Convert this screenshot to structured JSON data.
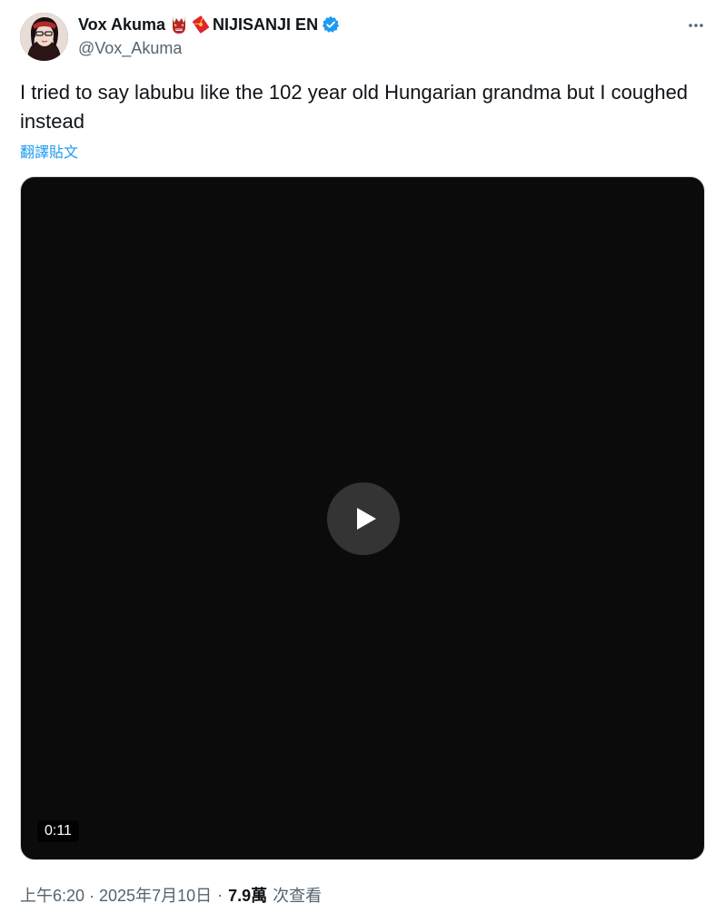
{
  "author": {
    "display_name": "Vox Akuma",
    "affiliation": "NIJISANJI EN",
    "handle": "@Vox_Akuma",
    "emojis": [
      "demon-mask-icon",
      "red-envelope-icon"
    ],
    "verified_icon": "verified-badge-icon",
    "avatar": "avatar"
  },
  "header": {
    "more_icon": "more-options-icon"
  },
  "tweet": {
    "text": "I tried to say labubu like the 102 year old Hungarian grandma but I coughed instead",
    "translate_label": "翻譯貼文"
  },
  "media": {
    "type": "video",
    "duration": "0:11",
    "play_icon": "play-icon"
  },
  "meta": {
    "timestamp": "上午6:20 · 2025年7月10日",
    "separator": "·",
    "views_count": "7.9萬",
    "views_label": "次查看"
  },
  "colors": {
    "accent": "#1d9bf0",
    "text_primary": "#0f1419",
    "text_secondary": "#536471",
    "video_bg": "#0b0b0b"
  }
}
